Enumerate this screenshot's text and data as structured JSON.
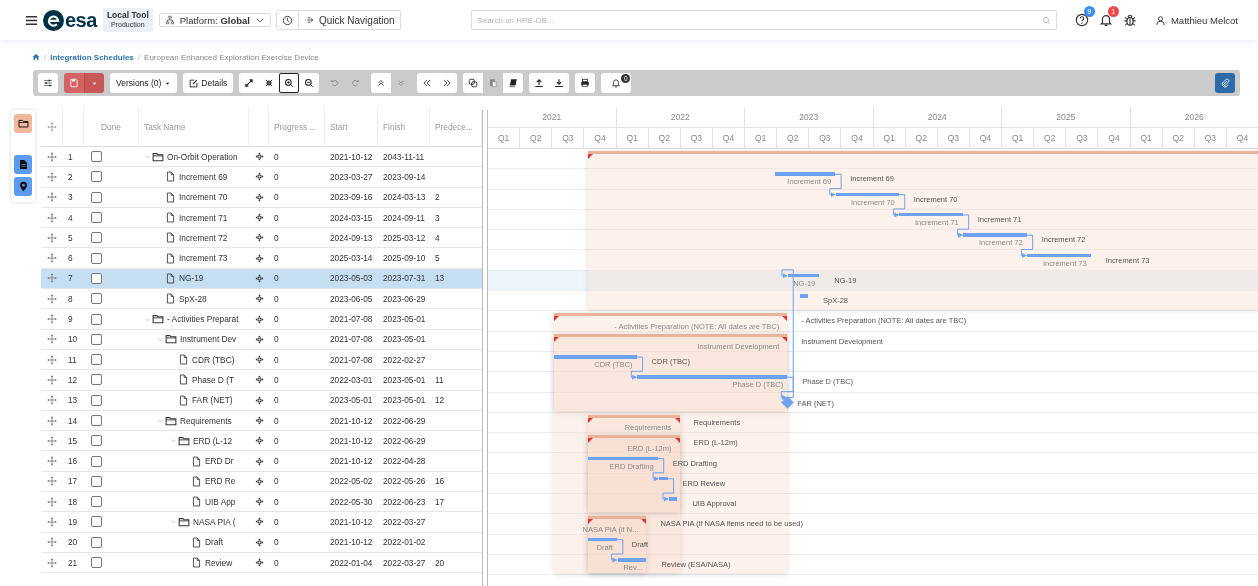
{
  "header": {
    "brand": "esa",
    "tool_badge": {
      "title": "Local Tool",
      "subtitle": "Production"
    },
    "platform": "Platform: **Global**",
    "quick_nav": "Quick Navigation",
    "search": {
      "placeholder": "Search on HRE-DB..."
    },
    "help_badge": "9",
    "notification_badge": "1",
    "user": "Matthieu Melcot"
  },
  "breadcrumb": [
    {
      "kind": "home"
    },
    {
      "kind": "separator",
      "text": "/"
    },
    {
      "kind": "link",
      "text": "Integration Schedules"
    },
    {
      "kind": "separator",
      "text": "/"
    },
    {
      "kind": "current",
      "text": "European Enhanced Exploration Exercise Device"
    }
  ],
  "toolbar": {
    "groups": [
      {
        "buttons": [
          {
            "kind": "sliders",
            "selected": false,
            "disabled": false
          }
        ]
      },
      {
        "buttons": [
          {
            "kind": "save",
            "selected": false,
            "disabled": false
          },
          {
            "kind": "save-menu",
            "selected": false,
            "disabled": false
          }
        ]
      },
      {
        "buttons": [
          {
            "kind": "versions",
            "label": "Versions (0)",
            "selected": false,
            "disabled": false
          }
        ]
      },
      {
        "buttons": [
          {
            "kind": "details",
            "label": "Details",
            "selected": false,
            "disabled": false
          }
        ]
      },
      {
        "buttons": [
          {
            "kind": "expand",
            "selected": false,
            "disabled": false
          },
          {
            "kind": "compress",
            "selected": false,
            "disabled": false
          },
          {
            "kind": "zoom-in",
            "selected": true,
            "disabled": false
          },
          {
            "kind": "zoom-out",
            "selected": false,
            "disabled": false
          }
        ]
      },
      {
        "buttons": [
          {
            "kind": "undo",
            "selected": false,
            "disabled": true
          },
          {
            "kind": "redo",
            "selected": false,
            "disabled": true
          }
        ]
      },
      {
        "buttons": [
          {
            "kind": "up",
            "selected": false,
            "disabled": false
          },
          {
            "kind": "down",
            "selected": false,
            "disabled": true
          }
        ]
      },
      {
        "buttons": [
          {
            "kind": "first",
            "selected": false,
            "disabled": false
          },
          {
            "kind": "last",
            "selected": false,
            "disabled": false
          }
        ]
      },
      {
        "buttons": [
          {
            "kind": "copy",
            "selected": false,
            "disabled": false
          },
          {
            "kind": "paste",
            "selected": false,
            "disabled": true
          },
          {
            "kind": "book",
            "selected": false,
            "disabled": false
          }
        ]
      },
      {
        "buttons": [
          {
            "kind": "upload",
            "selected": false,
            "disabled": false
          },
          {
            "kind": "download",
            "selected": false,
            "disabled": false
          }
        ]
      },
      {
        "buttons": [
          {
            "kind": "print",
            "selected": false,
            "disabled": false
          }
        ]
      },
      {
        "buttons": [
          {
            "kind": "alerts",
            "badge": "0",
            "selected": false,
            "disabled": false
          }
        ]
      }
    ],
    "end_button": {
      "kind": "attach"
    }
  },
  "rail": [
    {
      "kind": "folder",
      "selected": true
    },
    {
      "kind": "document",
      "selected": false
    },
    {
      "kind": "pin",
      "selected": false
    }
  ],
  "columns": [
    {
      "kind": "drag"
    },
    {
      "kind": "index"
    },
    {
      "kind": "done",
      "label": "Done"
    },
    {
      "kind": "name",
      "label": "Task Name"
    },
    {
      "kind": "locate"
    },
    {
      "kind": "progress",
      "label": "Progress ..."
    },
    {
      "kind": "start",
      "label": "Start"
    },
    {
      "kind": "finish",
      "label": "Finish"
    },
    {
      "kind": "predecessors",
      "label": "Predece..."
    }
  ],
  "timeline": [
    {
      "year": "2021",
      "quarters": [
        "Q1",
        "Q2",
        "Q3",
        "Q4"
      ]
    },
    {
      "year": "2022",
      "quarters": [
        "Q1",
        "Q2",
        "Q3",
        "Q4"
      ]
    },
    {
      "year": "2023",
      "quarters": [
        "Q1",
        "Q2",
        "Q3",
        "Q4"
      ]
    },
    {
      "year": "2024",
      "quarters": [
        "Q1",
        "Q2",
        "Q3",
        "Q4"
      ]
    },
    {
      "year": "2025",
      "quarters": [
        "Q1",
        "Q2",
        "Q3",
        "Q4"
      ]
    },
    {
      "year": "2026",
      "quarters": [
        "Q1",
        "Q2",
        "Q3",
        "Q4"
      ]
    }
  ],
  "tasks": [
    {
      "id": "1",
      "name": "On-Orbit Operation",
      "done": false,
      "progress": "0",
      "start": "2021-10-12",
      "finish": "2043-11-11",
      "expanded": true,
      "selected": false,
      "children": [
        {
          "id": "2",
          "name": "Increment 69",
          "done": false,
          "progress": "0",
          "start": "2023-03-27",
          "finish": "2023-09-14",
          "selected": false,
          "bar_label": "Increment 69",
          "side_label": "Increment 69"
        },
        {
          "id": "3",
          "name": "Increment 70",
          "done": false,
          "progress": "0",
          "start": "2023-09-16",
          "finish": "2024-03-13",
          "predecessors": "2",
          "selected": false,
          "bar_label": "Increment 70",
          "side_label": "Increment 70"
        },
        {
          "id": "4",
          "name": "Increment 71",
          "done": false,
          "progress": "0",
          "start": "2024-03-15",
          "finish": "2024-09-11",
          "predecessors": "3",
          "selected": false,
          "bar_label": "Increment 71",
          "side_label": "Increment 71"
        },
        {
          "id": "5",
          "name": "Increment 72",
          "done": false,
          "progress": "0",
          "start": "2024-09-13",
          "finish": "2025-03-12",
          "predecessors": "4",
          "selected": false,
          "bar_label": "Increment 72",
          "side_label": "Increment 72"
        },
        {
          "id": "6",
          "name": "Increment 73",
          "done": false,
          "progress": "0",
          "start": "2025-03-14",
          "finish": "2025-09-10",
          "predecessors": "5",
          "selected": false,
          "bar_label": "Increment 73",
          "side_label": "Increment 73"
        },
        {
          "id": "7",
          "name": "NG-19",
          "done": false,
          "progress": "0",
          "start": "2023-05-03",
          "finish": "2023-07-31",
          "predecessors": "13",
          "selected": true,
          "bar_label": "NG-19",
          "side_label": "NG-19"
        },
        {
          "id": "8",
          "name": "SpX-28",
          "done": false,
          "progress": "0",
          "start": "2023-06-05",
          "finish": "2023-06-29",
          "selected": false,
          "side_label": "SpX-28"
        }
      ]
    },
    {
      "id": "9",
      "name": "- Activities Preparat",
      "done": false,
      "progress": "0",
      "start": "2021-07-08",
      "finish": "2023-05-01",
      "expanded": true,
      "selected": false,
      "bar_label": "- Activities Preparation (NOTE: All dates are TBC)",
      "side_label": "- Activities Preparation (NOTE: All dates are TBC)",
      "children": [
        {
          "id": "10",
          "name": "Instrument Dev",
          "done": false,
          "progress": "0",
          "start": "2021-07-08",
          "finish": "2023-05-01",
          "expanded": true,
          "selected": false,
          "bar_label": "Instrument Development",
          "side_label": "Instrument Development",
          "children": [
            {
              "id": "11",
              "name": "CDR (TBC)",
              "done": false,
              "progress": "0",
              "start": "2021-07-08",
              "finish": "2022-02-27",
              "selected": false,
              "bar_label": "CDR (TBC)",
              "side_label": "CDR (TBC)"
            },
            {
              "id": "12",
              "name": "Phase D (T",
              "done": false,
              "progress": "0",
              "start": "2022-03-01",
              "finish": "2023-05-01",
              "predecessors": "11",
              "selected": false,
              "bar_label": "Phase D (TBC)",
              "side_label": "Phase D (TBC)"
            },
            {
              "id": "13",
              "name": "FAR (NET)",
              "done": false,
              "progress": "0",
              "start": "2023-05-01",
              "finish": "2023-05-01",
              "predecessors": "12",
              "selected": false,
              "side_label": "FAR (NET)"
            }
          ]
        },
        {
          "id": "14",
          "name": "Requirements",
          "done": false,
          "progress": "0",
          "start": "2021-10-12",
          "finish": "2022-06-29",
          "expanded": true,
          "selected": false,
          "bar_label": "Requirements",
          "side_label": "Requirements",
          "children": [
            {
              "id": "15",
              "name": "ERD (L-12",
              "done": false,
              "progress": "0",
              "start": "2021-10-12",
              "finish": "2022-06-29",
              "expanded": true,
              "selected": false,
              "bar_label": "ERD (L-12m)",
              "side_label": "ERD (L-12m)",
              "children": [
                {
                  "id": "16",
                  "name": "ERD Dr",
                  "done": false,
                  "progress": "0",
                  "start": "2021-10-12",
                  "finish": "2022-04-28",
                  "selected": false,
                  "bar_label": "ERD Drafting",
                  "side_label": "ERD Drafting"
                },
                {
                  "id": "17",
                  "name": "ERD Re",
                  "done": false,
                  "progress": "0",
                  "start": "2022-05-02",
                  "finish": "2022-05-26",
                  "predecessors": "16",
                  "selected": false,
                  "side_label": "ERD Review"
                },
                {
                  "id": "18",
                  "name": "UIB App",
                  "done": false,
                  "progress": "0",
                  "start": "2022-05-30",
                  "finish": "2022-06-23",
                  "predecessors": "17",
                  "selected": false,
                  "side_label": "UIB Approval"
                }
              ]
            },
            {
              "id": "19",
              "name": "NASA PIA (",
              "done": false,
              "progress": "0",
              "start": "2021-10-12",
              "finish": "2022-03-27",
              "expanded": true,
              "selected": false,
              "bar_label": "NASA PIA (if N...",
              "side_label": "NASA PIA (if NASA items need to be used)",
              "children": [
                {
                  "id": "20",
                  "name": "Draft",
                  "done": false,
                  "progress": "0",
                  "start": "2021-10-12",
                  "finish": "2022-01-02",
                  "selected": false,
                  "bar_label": "Draft",
                  "side_label": "Draft"
                },
                {
                  "id": "21",
                  "name": "Review",
                  "done": false,
                  "progress": "0",
                  "start": "2022-01-04",
                  "finish": "2022-03-27",
                  "predecessors": "20",
                  "selected": false,
                  "bar_label": "Rev...",
                  "side_label": "Review (ESA/NASA)"
                }
              ]
            }
          ]
        }
      ]
    }
  ]
}
